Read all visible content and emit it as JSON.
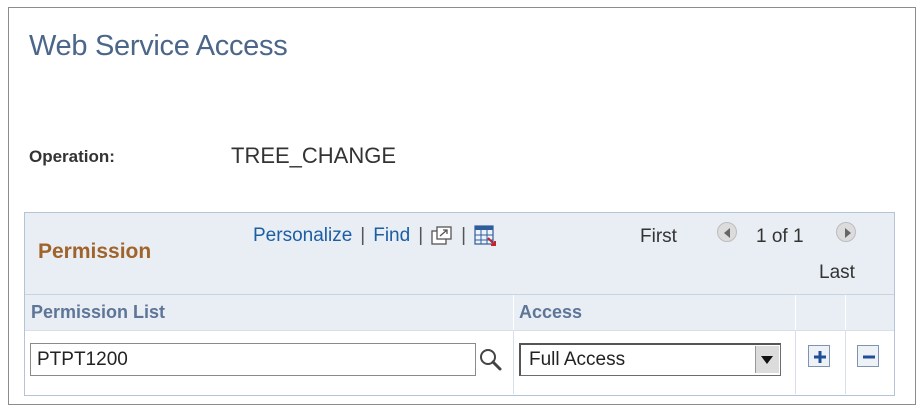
{
  "page": {
    "title": "Web Service Access",
    "operation_label": "Operation:",
    "operation_value": "TREE_CHANGE"
  },
  "grid": {
    "title": "Permission",
    "toolbar": {
      "personalize_label": "Personalize",
      "separator": "|",
      "find_label": "Find",
      "icons": [
        "new-window-icon",
        "download-spreadsheet-icon"
      ]
    },
    "nav": {
      "first_label": "First",
      "count_label": "1 of 1",
      "last_label": "Last"
    },
    "columns": [
      "Permission List",
      "Access"
    ],
    "rows": [
      {
        "permission_list": "PTPT1200",
        "access": "Full Access"
      }
    ],
    "row_actions": [
      "add-row-icon",
      "delete-row-icon"
    ]
  },
  "colors": {
    "title": "#4c668a",
    "grid_title": "#a0642a",
    "link": "#1c5ea3",
    "grid_bg": "#e9eef5",
    "column_header": "#5d7596"
  }
}
